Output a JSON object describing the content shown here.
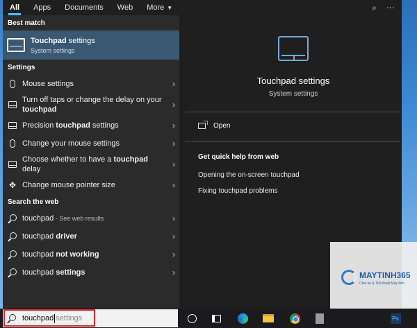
{
  "tabs": [
    {
      "label": "All",
      "active": true
    },
    {
      "label": "Apps",
      "active": false
    },
    {
      "label": "Documents",
      "active": false
    },
    {
      "label": "Web",
      "active": false
    },
    {
      "label": "More",
      "active": false
    }
  ],
  "tab_icons": [
    "feedback-icon",
    "more-options-icon"
  ],
  "best_match": {
    "heading": "Best match",
    "title_bold": "Touchpad",
    "title_rest": " settings",
    "subtitle": "System settings"
  },
  "settings": {
    "heading": "Settings",
    "items": [
      {
        "icon": "mouse-icon",
        "pre": "Mouse settings",
        "bold": "",
        "post": ""
      },
      {
        "icon": "touchpad-icon",
        "pre": "Turn off taps or change the delay on your ",
        "bold": "touchpad",
        "post": ""
      },
      {
        "icon": "touchpad-icon",
        "pre": "Precision ",
        "bold": "touchpad",
        "post": " settings"
      },
      {
        "icon": "mouse-icon",
        "pre": "Change your mouse settings",
        "bold": "",
        "post": ""
      },
      {
        "icon": "touchpad-icon",
        "pre": "Choose whether to have a ",
        "bold": "touchpad",
        "post": " delay"
      },
      {
        "icon": "pointer-icon",
        "pre": "Change mouse pointer size",
        "bold": "",
        "post": ""
      }
    ]
  },
  "web": {
    "heading": "Search the web",
    "items": [
      {
        "pre": "touchpad",
        "bold": "",
        "muted": " - See web results"
      },
      {
        "pre": "touchpad ",
        "bold": "driver",
        "muted": ""
      },
      {
        "pre": "touchpad ",
        "bold": "not working",
        "muted": ""
      },
      {
        "pre": "touchpad ",
        "bold": "settings",
        "muted": ""
      }
    ]
  },
  "preview": {
    "title": "Touchpad settings",
    "subtitle": "System settings",
    "open_label": "Open",
    "help_heading": "Get quick help from web",
    "help_links": [
      "Opening the on-screen touchpad",
      "Fixing touchpad problems"
    ]
  },
  "search": {
    "typed": "touchpad",
    "suggestion": " settings"
  },
  "watermark": {
    "brand": "MAYTINH365",
    "tagline": "Chia sẻ & Thủ thuật Máy tính"
  },
  "taskbar_icons": [
    "cortana-icon",
    "task-view-icon",
    "edge-icon",
    "file-explorer-icon",
    "chrome-icon",
    "calculator-icon",
    "photoshop-icon"
  ],
  "colors": {
    "accent": "#4cc2ff",
    "best_match_bg": "#3a5872",
    "highlight_border": "#e2262b"
  }
}
